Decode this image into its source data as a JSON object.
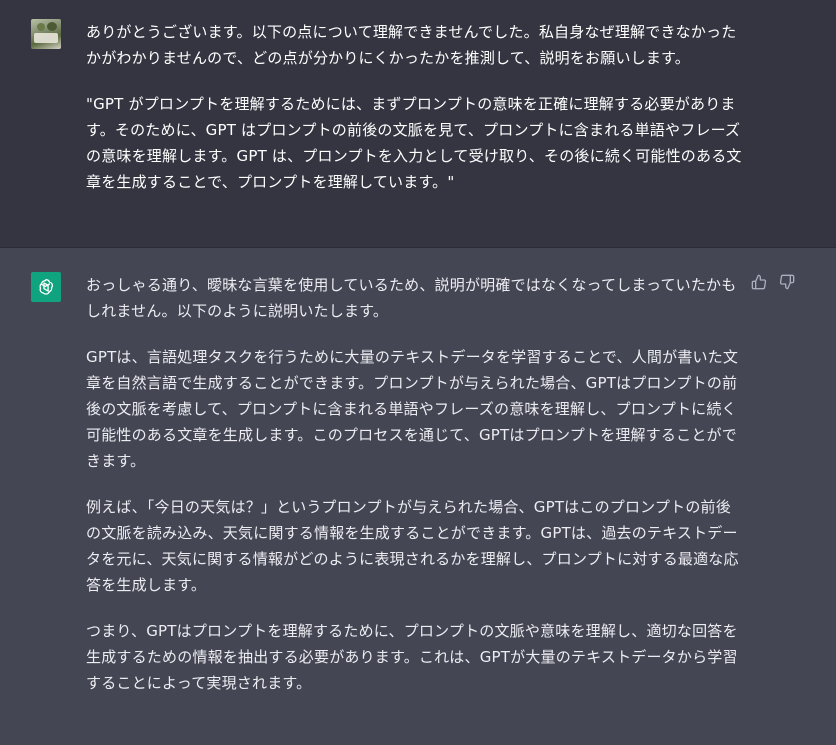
{
  "conversation": {
    "user_message": {
      "avatar_icon": "user-photo-avatar",
      "paragraphs": [
        "ありがとうございます。以下の点について理解できませんでした。私自身なぜ理解できなかったかがわかりませんので、どの点が分かりにくかったかを推測して、説明をお願いします。",
        "\"GPT がプロンプトを理解するためには、まずプロンプトの意味を正確に理解する必要があります。そのために、GPT はプロンプトの前後の文脈を見て、プロンプトに含まれる単語やフレーズの意味を理解します。GPT は、プロンプトを入力として受け取り、その後に続く可能性のある文章を生成することで、プロンプトを理解しています。\""
      ]
    },
    "assistant_message": {
      "avatar_icon": "openai-logo-icon",
      "avatar_color": "#10a37f",
      "paragraphs": [
        "おっしゃる通り、曖昧な言葉を使用しているため、説明が明確ではなくなってしまっていたかもしれません。以下のように説明いたします。",
        "GPTは、言語処理タスクを行うために大量のテキストデータを学習することで、人間が書いた文章を自然言語で生成することができます。プロンプトが与えられた場合、GPTはプロンプトの前後の文脈を考慮して、プロンプトに含まれる単語やフレーズの意味を理解し、プロンプトに続く可能性のある文章を生成します。このプロセスを通じて、GPTはプロンプトを理解することができます。",
        "例えば、「今日の天気は？」というプロンプトが与えられた場合、GPTはこのプロンプトの前後の文脈を読み込み、天気に関する情報を生成することができます。GPTは、過去のテキストデータを元に、天気に関する情報がどのように表現されるかを理解し、プロンプトに対する最適な応答を生成します。",
        "つまり、GPTはプロンプトを理解するために、プロンプトの文脈や意味を理解し、適切な回答を生成するための情報を抽出する必要があります。これは、GPTが大量のテキストデータから学習することによって実現されます。"
      ],
      "actions": [
        {
          "icon": "thumbs-up-icon"
        },
        {
          "icon": "thumbs-down-icon"
        }
      ]
    }
  },
  "colors": {
    "user_bg": "#343541",
    "assistant_bg": "#444654",
    "text": "#ececf1",
    "icon": "#acacbe"
  }
}
